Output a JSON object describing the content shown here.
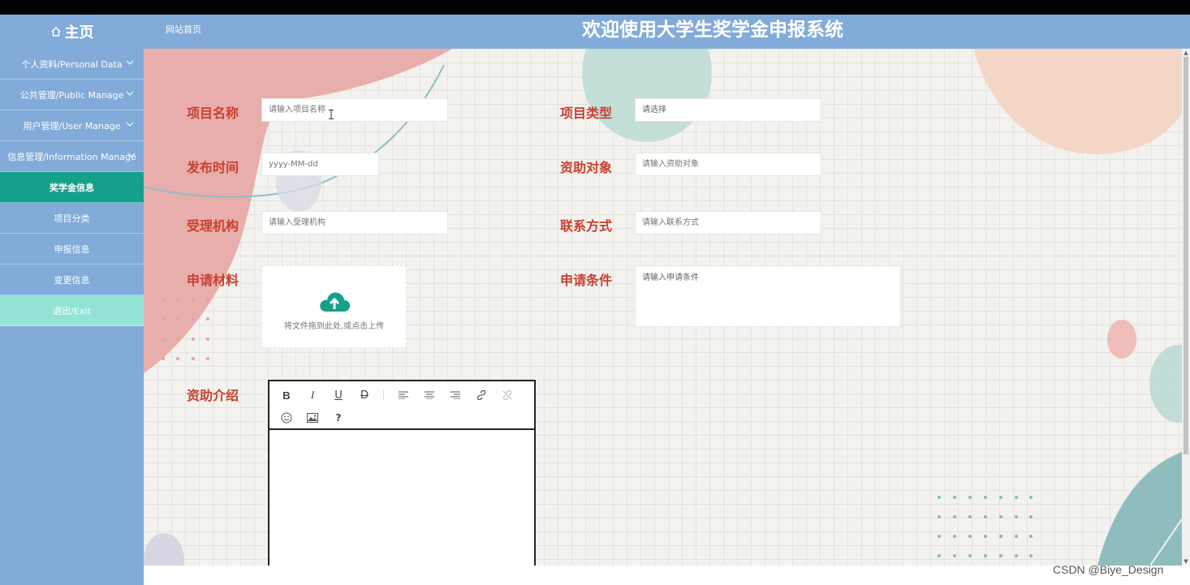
{
  "header": {
    "home_label": "主页",
    "site_link": "网站首页",
    "title": "欢迎使用大学生奖学金申报系统"
  },
  "sidebar": {
    "items": [
      {
        "label": "个人资料/Personal Data"
      },
      {
        "label": "公共管理/Public Manage"
      },
      {
        "label": "用户管理/User Manage"
      },
      {
        "label": "信息管理/Information Manage"
      },
      {
        "label": "奖学金信息"
      },
      {
        "label": "项目分类"
      },
      {
        "label": "申报信息"
      },
      {
        "label": "变更信息"
      },
      {
        "label": "退出/Exit"
      }
    ]
  },
  "form": {
    "project_name": {
      "label": "项目名称",
      "placeholder": "请输入项目名称"
    },
    "project_type": {
      "label": "项目类型",
      "placeholder": "请选择"
    },
    "publish_time": {
      "label": "发布时间",
      "placeholder": "yyyy-MM-dd"
    },
    "funding_target": {
      "label": "资助对象",
      "placeholder": "请输入资助对象"
    },
    "agency": {
      "label": "受理机构",
      "placeholder": "请输入受理机构"
    },
    "contact": {
      "label": "联系方式",
      "placeholder": "请输入联系方式"
    },
    "materials": {
      "label": "申请材料",
      "upload_text": "将文件拖到此处,或点击上传"
    },
    "conditions": {
      "label": "申请条件",
      "placeholder": "请输入申请条件"
    },
    "intro": {
      "label": "资助介绍"
    }
  },
  "editor": {
    "buttons": [
      "bold-icon",
      "italic-icon",
      "underline-icon",
      "strikethrough-icon",
      "align-left-icon",
      "align-center-icon",
      "align-right-icon",
      "link-icon",
      "unlink-icon",
      "emoji-icon",
      "image-icon",
      "help-icon"
    ]
  },
  "watermark": "CSDN @Biye_Design",
  "colors": {
    "header_bg": "#82abd9",
    "active_menu": "#16a08c",
    "exit_menu": "#94e3d5",
    "label_red": "#c8402e"
  }
}
